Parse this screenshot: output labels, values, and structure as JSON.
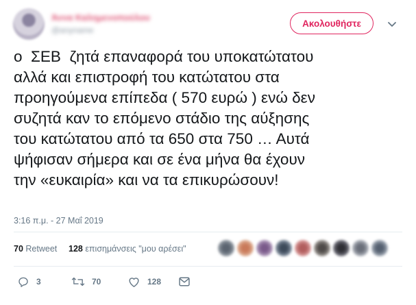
{
  "header": {
    "display_name": "Άννα Καλημενοπούλου",
    "handle": "@anyname",
    "follow_label": "Ακολουθήστε",
    "accent_color": "#e0245e"
  },
  "tweet": {
    "lines": [
      "ο  ΣΕΒ  ζητά επαναφορά του υποκατώτατου",
      "αλλά και επιστροφή του κατώτατου στα",
      "προηγούμενα επίπεδα ( 570 ευρώ ) ενώ δεν",
      "συζητά καν το επόμενο στάδιο της αύξησης",
      "του κατώτατου από τα 650 στα 750 … Αυτά",
      "ψήφισαν σήμερα και σε ένα μήνα θα έχουν",
      "την «ευκαιρία» και να τα επικυρώσουν!"
    ],
    "timestamp": "3:16 π.μ. - 27 Μαΐ 2019"
  },
  "stats": {
    "retweet_count": "70",
    "retweet_label": "Retweet",
    "like_count": "128",
    "like_label": "επισημάνσεις \"μου αρέσει\""
  },
  "actions": {
    "reply_count": "3",
    "retweet_count": "70",
    "like_count": "128",
    "icons": [
      "reply-icon",
      "retweet-icon",
      "heart-icon",
      "direct-message-icon"
    ]
  }
}
